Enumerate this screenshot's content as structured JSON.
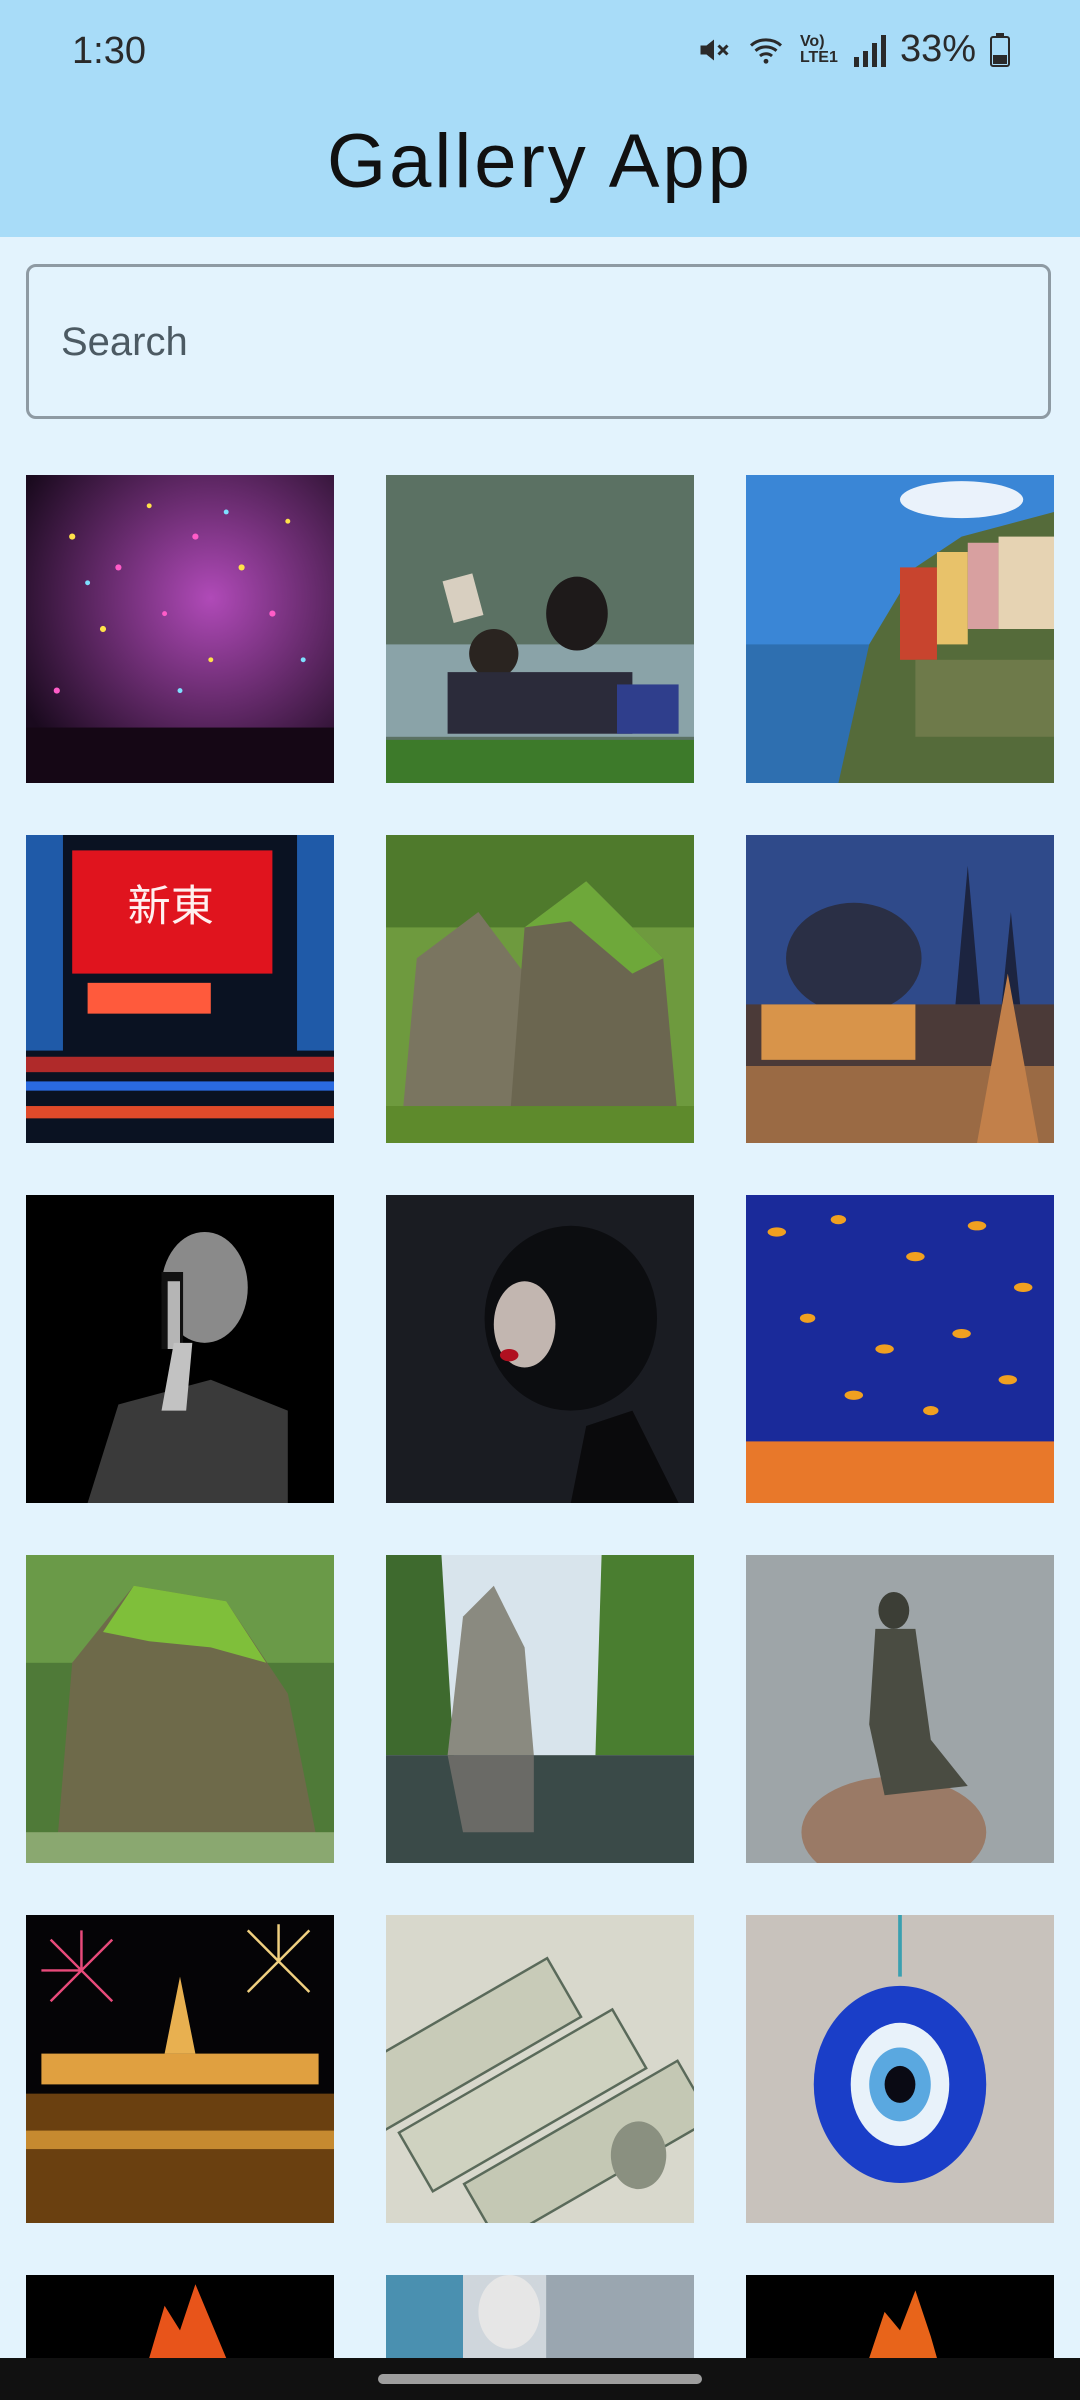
{
  "status_bar": {
    "time": "1:30",
    "battery": "33%",
    "network_label": "Vo) LTE1",
    "icons": [
      "mute-icon",
      "wifi-icon",
      "lte-icon",
      "signal-icon",
      "battery-icon"
    ]
  },
  "app": {
    "title": "Gallery App"
  },
  "search": {
    "placeholder": "Search",
    "value": ""
  },
  "gallery": {
    "images": [
      "confetti-concert",
      "couple-reading-on-grass",
      "cliffside-village",
      "neon-sign-street",
      "mossy-rock-faces",
      "christmas-market",
      "man-finger-on-lips",
      "dark-vampire-woman",
      "orange-leaves-on-blue",
      "moss-covered-head-sculpture",
      "canyon-lake-reflection",
      "little-mermaid-statue",
      "fireworks-over-parliament",
      "dollar-bills",
      "evil-eye-amulet",
      "fire-on-black",
      "einstein-collage",
      "flame-on-black"
    ]
  },
  "colors": {
    "app_bar": "#a8dcf8",
    "background": "#e3f3fd",
    "search_border": "#8e9aa3"
  }
}
